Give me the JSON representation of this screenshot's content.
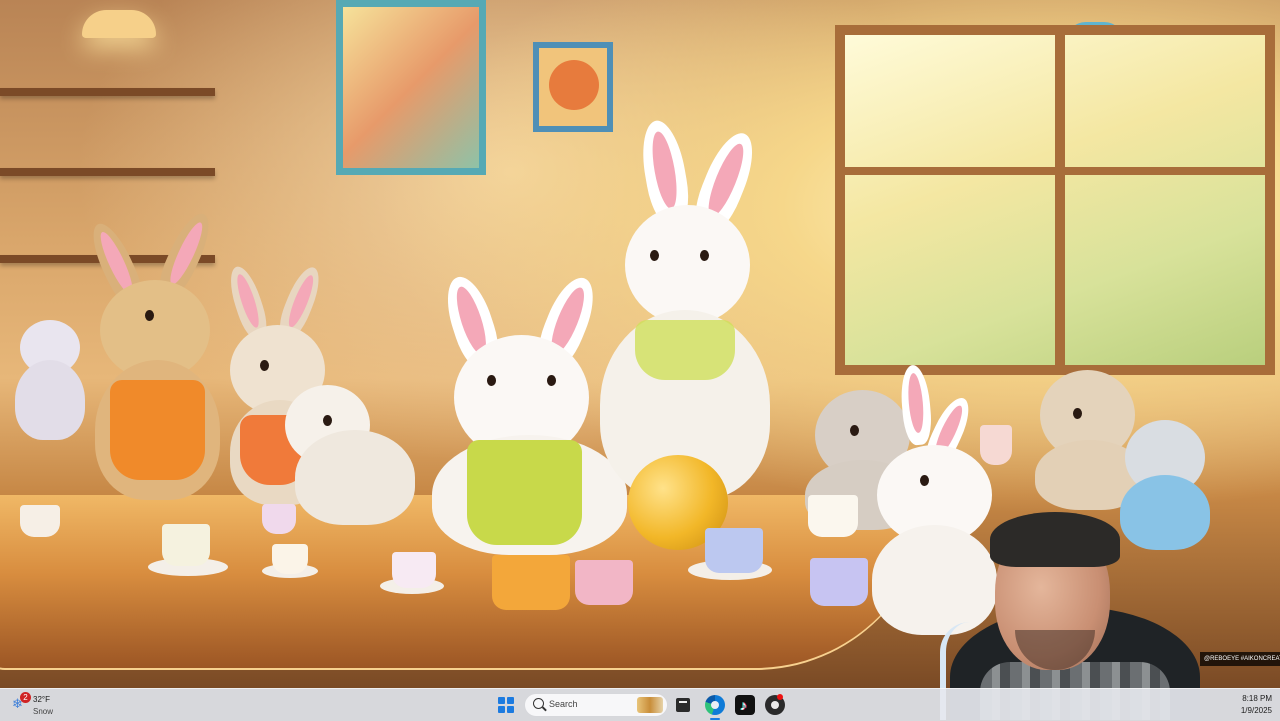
{
  "wallpaper": {
    "description_icon": "tea-party-bunnies-wallpaper-icon"
  },
  "overlay": {
    "credit_text": "@REBOEYE  #AIKONCREATED"
  },
  "taskbar": {
    "weather": {
      "badge": "2",
      "temperature": "32°F",
      "condition": "Snow",
      "icon": "snow-cloud-icon"
    },
    "search": {
      "placeholder": "Search",
      "icon": "search-icon"
    },
    "pinned_apps": [
      {
        "name": "file-explorer-icon"
      },
      {
        "name": "edge-browser-icon"
      },
      {
        "name": "tiktok-icon"
      },
      {
        "name": "obs-studio-icon"
      }
    ],
    "clock": {
      "time": "8:18 PM",
      "date": "1/9/2025"
    },
    "colors": {
      "accent": "#1c7be0",
      "badge": "#d02424"
    }
  }
}
